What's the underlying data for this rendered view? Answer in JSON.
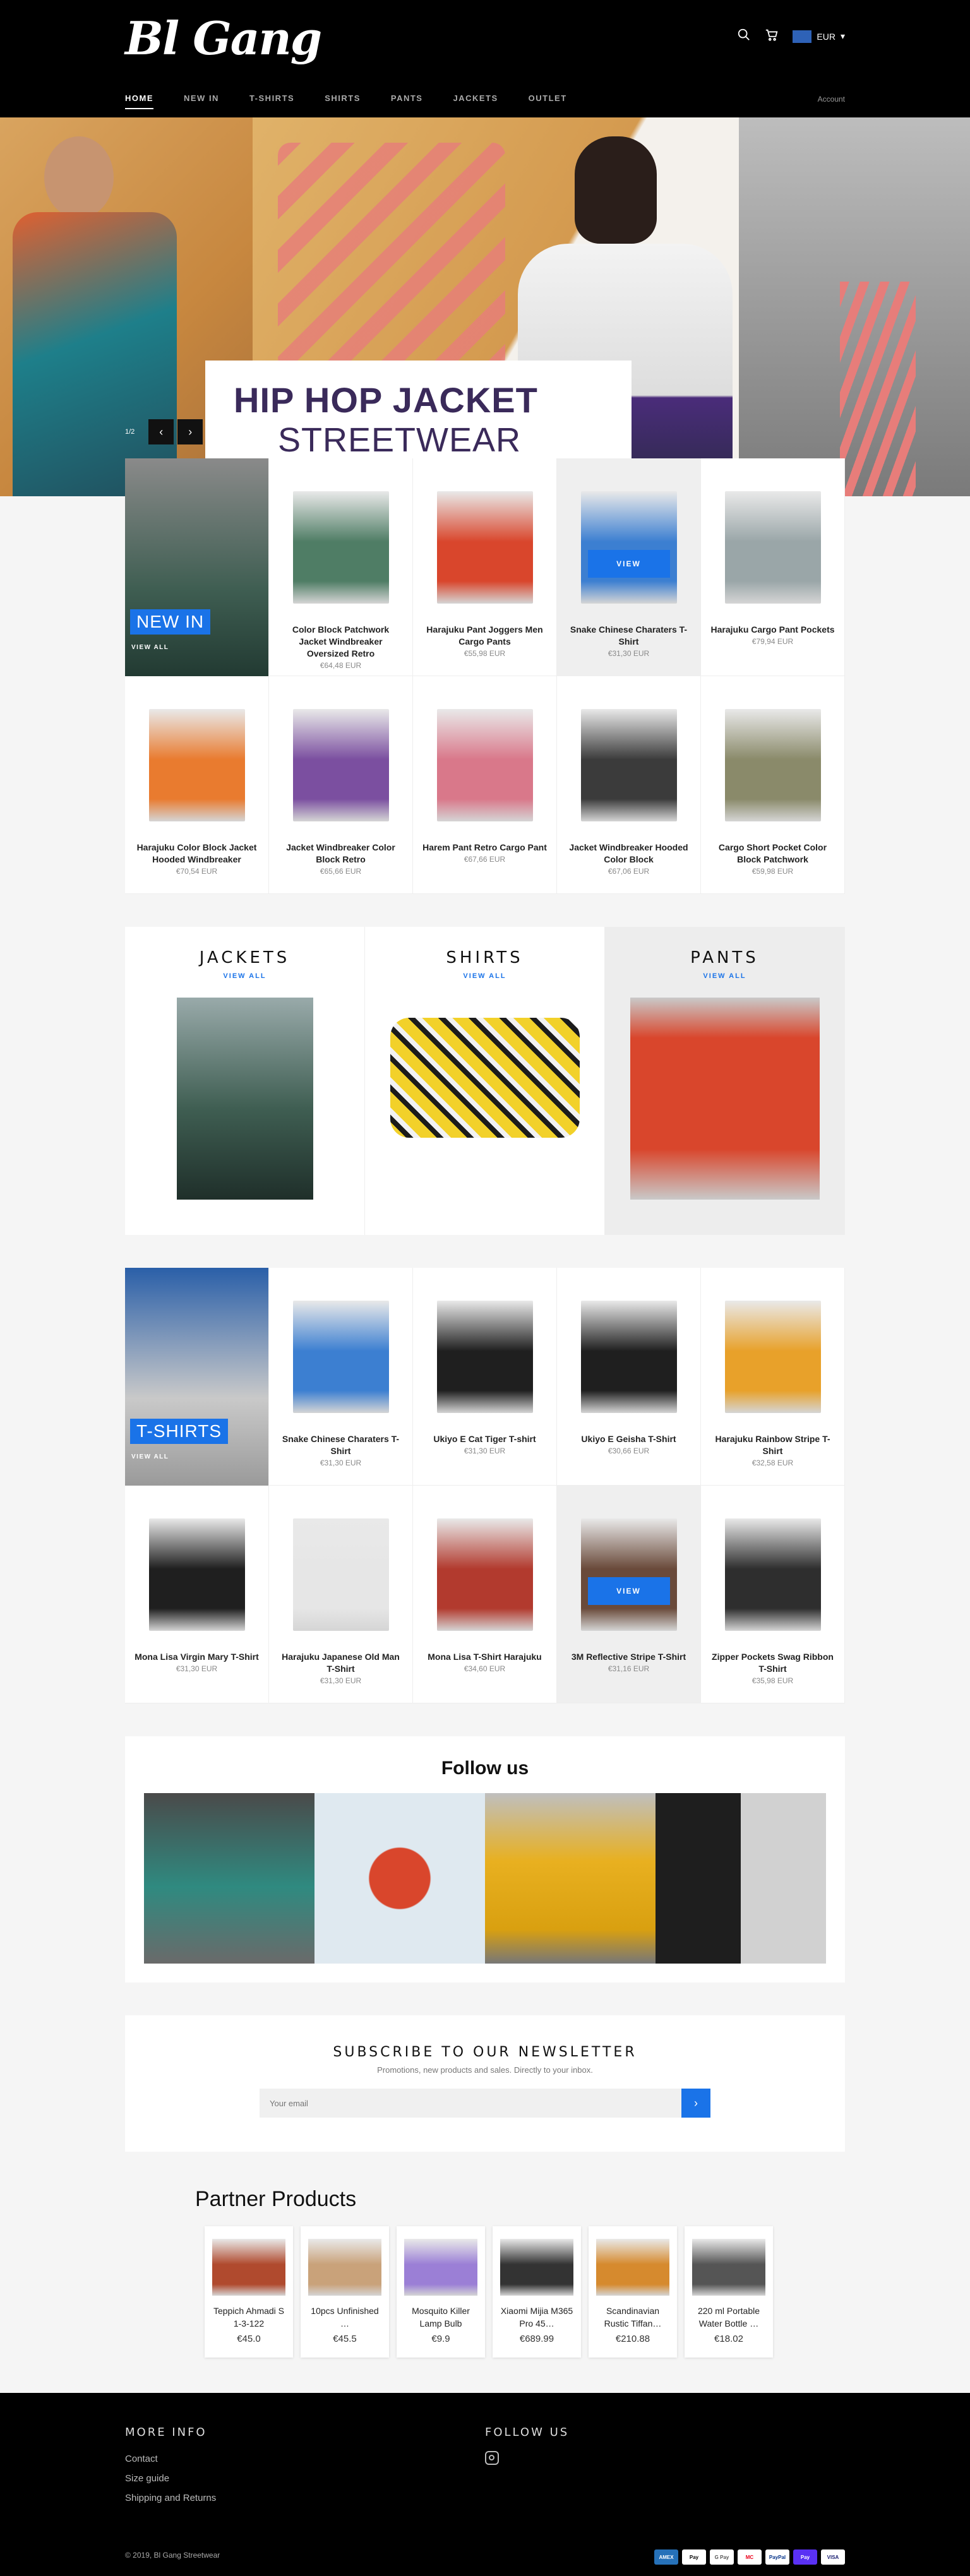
{
  "header": {
    "logo": "Bl Gang",
    "currency": "EUR",
    "account": "Account",
    "nav": [
      "HOME",
      "NEW IN",
      "T-SHIRTS",
      "SHIRTS",
      "PANTS",
      "JACKETS",
      "OUTLET"
    ]
  },
  "hero": {
    "line1": "HIP HOP JACKET",
    "line2": "STREETWEAR",
    "counter": "1/2",
    "prev": "‹",
    "next": "›"
  },
  "new_in": {
    "tag": "NEW IN",
    "view_all": "VIEW ALL",
    "view_label": "VIEW",
    "products": [
      {
        "name": "Color Block Patchwork Jacket Windbreaker Oversized Retro",
        "price": "€64,48 EUR",
        "color": "#4f7d65"
      },
      {
        "name": "Harajuku Pant Joggers Men Cargo Pants",
        "price": "€55,98 EUR",
        "color": "#d9462c"
      },
      {
        "name": "Snake Chinese Charaters T-Shirt",
        "price": "€31,30 EUR",
        "color": "#3c7fd1"
      },
      {
        "name": "Harajuku Cargo Pant Pockets",
        "price": "€79,94 EUR",
        "color": "#9aa6a8"
      },
      {
        "name": "Harajuku Color Block Jacket Hooded Windbreaker",
        "price": "€70,54 EUR",
        "color": "#e97b2f"
      },
      {
        "name": "Jacket Windbreaker Color Block Retro",
        "price": "€65,66 EUR",
        "color": "#7b4fa0"
      },
      {
        "name": "Harem Pant Retro Cargo Pant",
        "price": "€67,66 EUR",
        "color": "#d9788a"
      },
      {
        "name": "Jacket Windbreaker Hooded Color Block",
        "price": "€67,06 EUR",
        "color": "#3b3b3b"
      },
      {
        "name": "Cargo Short Pocket Color Block Patchwork",
        "price": "€59,98 EUR",
        "color": "#8a8a6a"
      }
    ]
  },
  "collections": [
    {
      "title": "JACKETS",
      "view_all": "VIEW ALL"
    },
    {
      "title": "SHIRTS",
      "view_all": "VIEW ALL"
    },
    {
      "title": "PANTS",
      "view_all": "VIEW ALL"
    }
  ],
  "tshirts": {
    "tag": "T-SHIRTS",
    "view_all": "VIEW ALL",
    "view_label": "VIEW",
    "products": [
      {
        "name": "Snake Chinese Charaters T-Shirt",
        "price": "€31,30 EUR",
        "color": "#3c7fd1"
      },
      {
        "name": "Ukiyo E Cat Tiger T-shirt",
        "price": "€31,30 EUR",
        "color": "#1f1f1f"
      },
      {
        "name": "Ukiyo E Geisha T-Shirt",
        "price": "€30,66 EUR",
        "color": "#1f1f1f"
      },
      {
        "name": "Harajuku Rainbow Stripe T-Shirt",
        "price": "€32,58 EUR",
        "color": "#e8a12a"
      },
      {
        "name": "Mona Lisa Virgin Mary T-Shirt",
        "price": "€31,30 EUR",
        "color": "#1f1f1f"
      },
      {
        "name": "Harajuku Japanese Old Man T-Shirt",
        "price": "€31,30 EUR",
        "color": "#e6e6e6"
      },
      {
        "name": "Mona Lisa T-Shirt Harajuku",
        "price": "€34,60 EUR",
        "color": "#b23a2e"
      },
      {
        "name": "3M Reflective Stripe T-Shirt",
        "price": "€31,16 EUR",
        "color": "#6a4a3a"
      },
      {
        "name": "Zipper Pockets Swag Ribbon T-Shirt",
        "price": "€35,98 EUR",
        "color": "#2e2e2e"
      }
    ]
  },
  "follow": {
    "title": "Follow us"
  },
  "newsletter": {
    "title": "SUBSCRIBE TO OUR NEWSLETTER",
    "subtitle": "Promotions, new products and sales. Directly to your inbox.",
    "placeholder": "Your email",
    "submit": "›"
  },
  "partner": {
    "title": "Partner Products",
    "items": [
      {
        "name": "Teppich Ahmadi S 1-3-122",
        "price": "€45.0",
        "color": "#b04a2e"
      },
      {
        "name": "10pcs Unfinished …",
        "price": "€45.5",
        "color": "#c9a27a"
      },
      {
        "name": "Mosquito Killer Lamp Bulb",
        "price": "€9.9",
        "color": "#9b7fd6"
      },
      {
        "name": "Xiaomi Mijia M365 Pro 45…",
        "price": "€689.99",
        "color": "#333333"
      },
      {
        "name": "Scandinavian Rustic Tiffan…",
        "price": "€210.88",
        "color": "#d68a2e"
      },
      {
        "name": "220 ml Portable Water Bottle …",
        "price": "€18.02",
        "color": "#555555"
      }
    ]
  },
  "footer": {
    "more_info": "MORE INFO",
    "follow_us": "FOLLOW US",
    "links": [
      "Contact",
      "Size guide",
      "Shipping and Returns"
    ],
    "copyright": "© 2019, Bl Gang Streetwear",
    "payments": [
      "AMEX",
      "Pay",
      "G Pay",
      "MC",
      "PayPal",
      "Pay",
      "VISA"
    ]
  }
}
